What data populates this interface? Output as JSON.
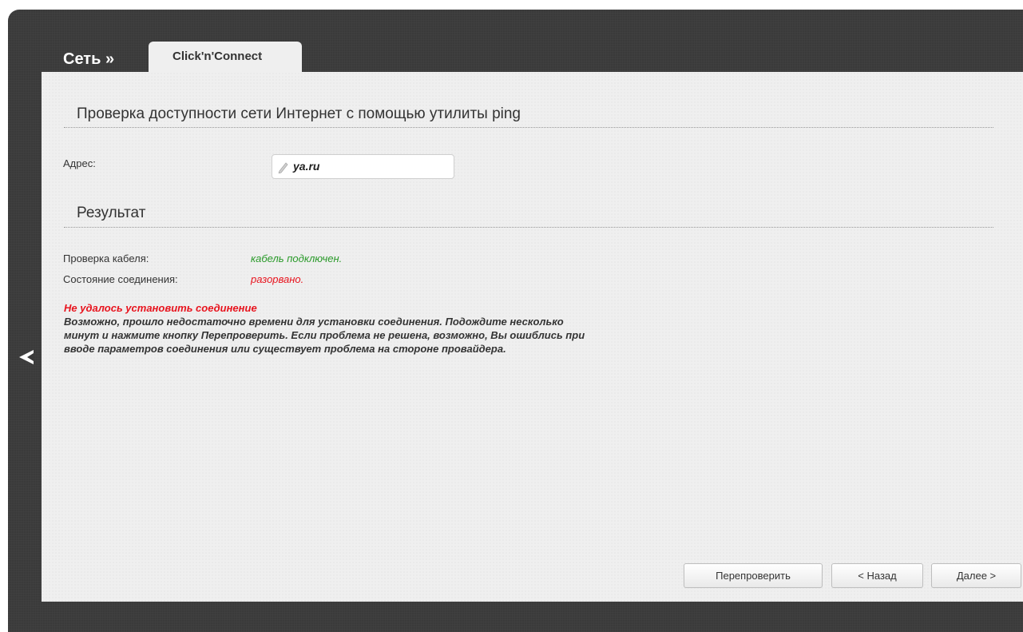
{
  "header": {
    "breadcrumb": "Сеть »",
    "tab_label": "Click'n'Connect"
  },
  "ping": {
    "title": "Проверка доступности сети Интернет с помощью утилиты ping",
    "address_label": "Адрес:",
    "address_value": "ya.ru"
  },
  "result": {
    "title": "Результат",
    "cable_label": "Проверка кабеля:",
    "cable_value": "кабель подключен.",
    "connection_label": "Состояние соединения:",
    "connection_value": "разорвано.",
    "error_title": "Не удалось установить соединение",
    "error_line1": "Возможно, прошло недостаточно времени для установки соединения. Подождите несколько",
    "error_line2": "минут и нажмите кнопку Перепроверить. Если проблема не решена, возможно, Вы ошиблись при",
    "error_line3": "вводе параметров соединения или существует проблема на стороне провайдера."
  },
  "buttons": {
    "recheck": "Перепроверить",
    "back": "< Назад",
    "next": "Далее >"
  },
  "colors": {
    "frame_bg": "#3a3a3a",
    "panel_bg": "#efefef",
    "status_ok": "#2a9a2a",
    "status_error": "#e8141e"
  },
  "icons": {
    "address_field": "pencil-icon",
    "sidebar_toggle": "chevron-left-icon"
  }
}
